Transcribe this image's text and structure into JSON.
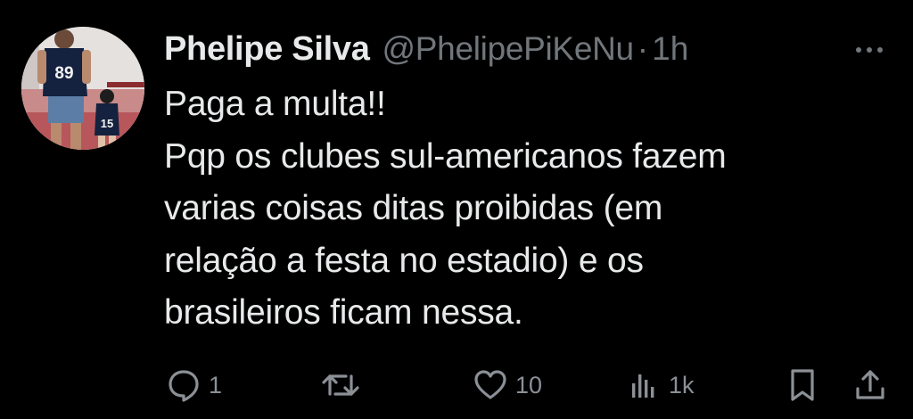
{
  "tweet": {
    "display_name": "Phelipe Silva",
    "handle": "@PhelipePiKeNu",
    "separator": "·",
    "time": "1h",
    "avatar_jersey_adult": "89",
    "avatar_jersey_child": "15",
    "body_lines": [
      "Paga a multa!!",
      "Pqp os clubes sul-americanos fazem",
      "varias coisas ditas proibidas (em",
      "relação a festa no estadio) e os",
      "brasileiros ficam nessa."
    ]
  },
  "actions": {
    "reply_count": "1",
    "retweet_count": "",
    "like_count": "10",
    "views_count": "1k"
  },
  "icons": {
    "more": "more-dots-icon",
    "reply": "reply-icon",
    "retweet": "retweet-icon",
    "like": "heart-icon",
    "views": "views-chart-icon",
    "bookmark": "bookmark-icon",
    "share": "share-icon"
  },
  "colors": {
    "background": "#000000",
    "primary_text": "#e7e9ea",
    "secondary_text": "#71767b"
  }
}
